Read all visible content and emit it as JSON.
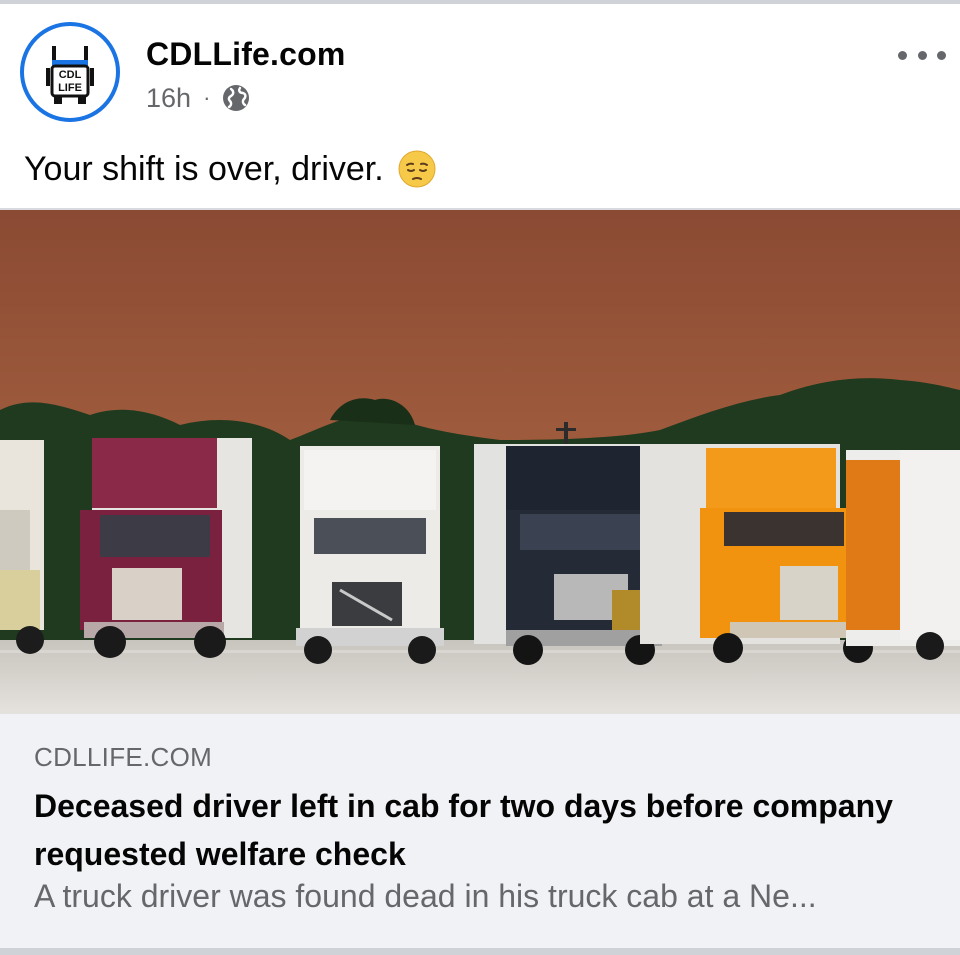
{
  "post": {
    "page_name": "CDLLife.com",
    "time": "16h",
    "separator": "·",
    "privacy_icon": "globe-icon",
    "more_icon": "more-horizontal-icon",
    "caption": "Your shift is over, driver.",
    "caption_emoji": "pensive-face-emoji"
  },
  "avatar": {
    "logo_text_top": "CDL",
    "logo_text_bottom": "LIFE",
    "ring_color": "#1b74e4"
  },
  "link": {
    "image_description_icon": "parked-trucks-photo",
    "domain": "CDLLIFE.COM",
    "title": "Deceased driver left in cab for two days before company requested welfare check",
    "description": "A truck driver was found dead in his truck cab at a Ne..."
  },
  "colors": {
    "text_primary": "#050505",
    "text_secondary": "#65676b",
    "preview_bg": "#f0f2f5",
    "accent": "#1b74e4"
  }
}
